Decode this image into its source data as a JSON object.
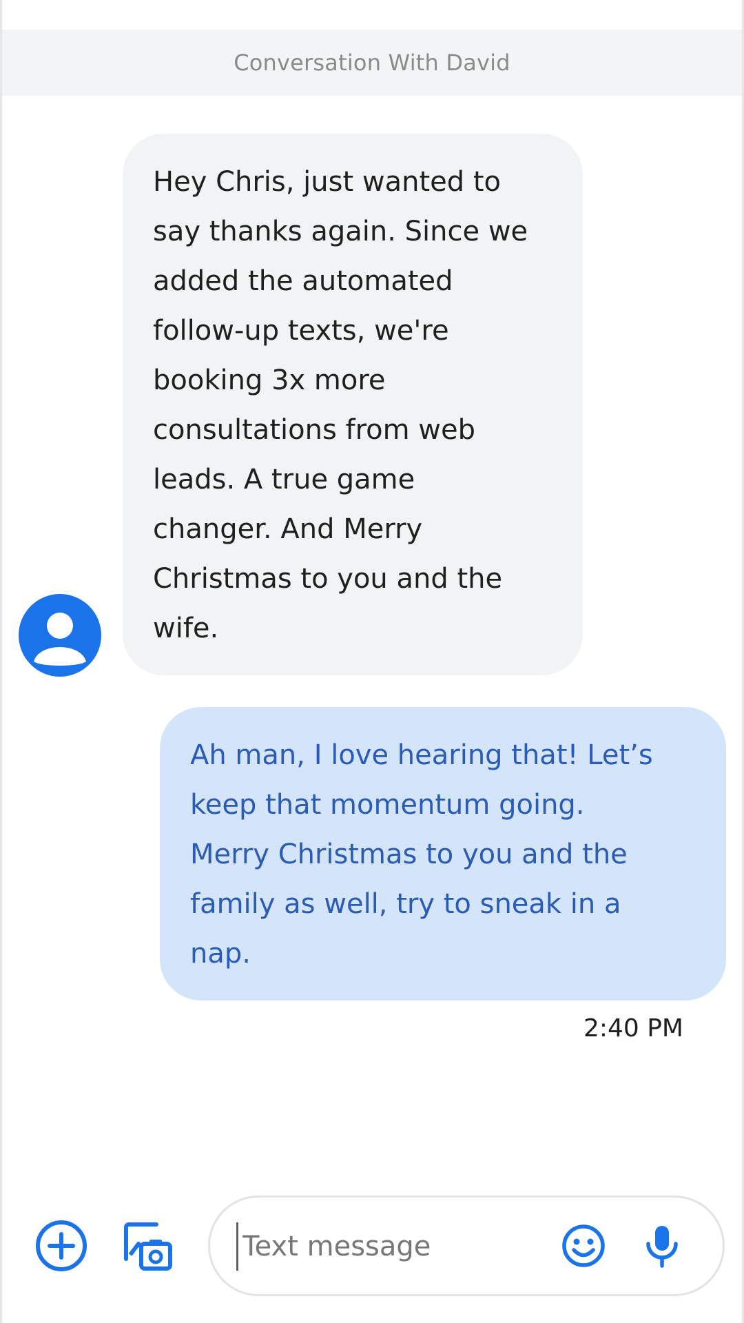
{
  "header": {
    "title": "Conversation With David"
  },
  "messages": [
    {
      "direction": "incoming",
      "text": "Hey Chris, just wanted to\nsay thanks again. Since we\nadded the automated\nfollow-up texts, we're\nbooking 3x more\nconsultations from web\nleads. A true game\nchanger. And Merry\nChristmas to you and the\nwife."
    },
    {
      "direction": "outgoing",
      "text": "Ah man, I love hearing that! Let’s\nkeep that momentum going.\nMerry Christmas to you and the\nfamily as well, try to sneak in a\nnap.",
      "time": "2:40 PM"
    }
  ],
  "composer": {
    "placeholder": "Text message",
    "value": "",
    "icons": {
      "add": "add-circle-icon",
      "gallery": "gallery-icon",
      "emoji": "emoji-icon",
      "mic": "microphone-icon"
    }
  },
  "colors": {
    "accent": "#1a73e8",
    "incoming_bubble": "#f1f3f4",
    "outgoing_bubble": "#d4e5fb",
    "outgoing_text": "#2a5bb5",
    "header_bg": "#f3f4f5"
  }
}
